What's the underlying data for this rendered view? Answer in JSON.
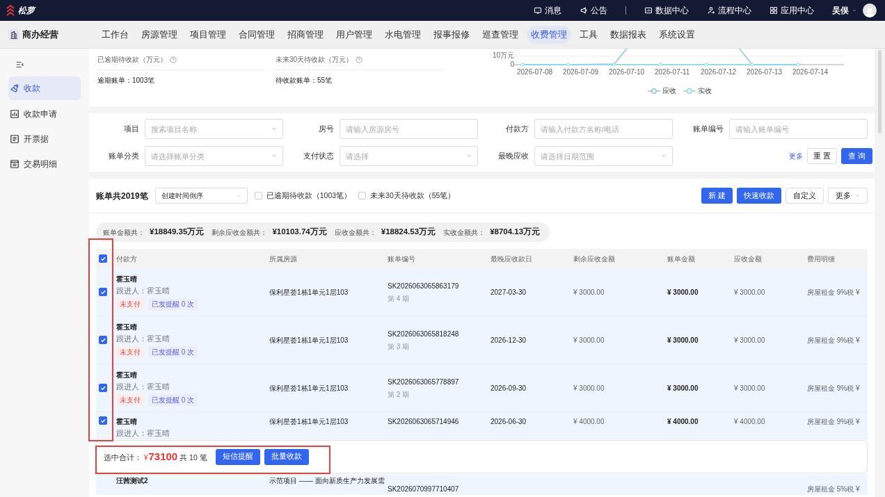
{
  "top_bar": {
    "brand": "松萝",
    "links": [
      {
        "label": "消息"
      },
      {
        "label": "公告"
      },
      {
        "label": "数据中心"
      },
      {
        "label": "流程中心"
      },
      {
        "label": "应用中心"
      }
    ],
    "user": "吴俣"
  },
  "nav": {
    "module": "商办经营",
    "tabs": [
      {
        "label": "工作台",
        "selected": false
      },
      {
        "label": "房源管理",
        "selected": false
      },
      {
        "label": "项目管理",
        "selected": false
      },
      {
        "label": "合同管理",
        "selected": false
      },
      {
        "label": "招商管理",
        "selected": false
      },
      {
        "label": "用户管理",
        "selected": false
      },
      {
        "label": "水电管理",
        "selected": false
      },
      {
        "label": "报事报修",
        "selected": false
      },
      {
        "label": "巡查管理",
        "selected": false
      },
      {
        "label": "收费管理",
        "selected": true
      },
      {
        "label": "工具",
        "selected": false
      },
      {
        "label": "数据报表",
        "selected": false
      },
      {
        "label": "系统设置",
        "selected": false
      }
    ]
  },
  "sidebar": {
    "items": [
      {
        "label": "收款",
        "selected": true
      },
      {
        "label": "收款申请",
        "selected": false
      },
      {
        "label": "开票据",
        "selected": false
      },
      {
        "label": "交易明细",
        "selected": false
      }
    ]
  },
  "stats": [
    {
      "label": "已逾期待收款（万元）",
      "sub": "逾期账单：1003笔"
    },
    {
      "label": "未来30天待收款（万元）",
      "sub": "待收款账单：55笔"
    }
  ],
  "trend_chart": {
    "y_labels": [
      "10万元",
      "0"
    ],
    "x_labels": [
      "2026-07-08",
      "2026-07-09",
      "2026-07-10",
      "2026-07-11",
      "2026-07-12",
      "2026-07-13",
      "2026-07-14"
    ],
    "legend": [
      {
        "label": "应收",
        "color": "#8ec3ea"
      },
      {
        "label": "实收",
        "color": "#86dcef"
      }
    ]
  },
  "filters": [
    {
      "label": "项目",
      "placeholder": "搜索项目名称",
      "kind": "select"
    },
    {
      "label": "房号",
      "placeholder": "请输入房源房号",
      "kind": "input"
    },
    {
      "label": "付款方",
      "placeholder": "请输入付款方名称/电话",
      "kind": "input"
    },
    {
      "label": "账单编号",
      "placeholder": "请输入账单编号",
      "kind": "input"
    },
    {
      "label": "账单分类",
      "placeholder": "请选择账单分类",
      "kind": "select"
    },
    {
      "label": "支付状态",
      "placeholder": "请选择",
      "kind": "select"
    },
    {
      "label": "最晚应收",
      "placeholder": "请选择日期范围",
      "kind": "select"
    }
  ],
  "filter_actions": {
    "more": "更多",
    "reset": "重 置",
    "search": "查 询"
  },
  "toolbar": {
    "title": "账单共2019笔",
    "sort": "创建时间倒序",
    "options": [
      {
        "label": "已逾期待收款（1003笔）",
        "checked": false
      },
      {
        "label": "未来30天待收款（55笔）",
        "checked": false
      }
    ],
    "buttons": [
      {
        "label": "新 建",
        "kind": "primary"
      },
      {
        "label": "快速收款",
        "kind": "primary"
      },
      {
        "label": "自定义",
        "kind": "plain"
      },
      {
        "label": "更多",
        "kind": "dropdown"
      }
    ]
  },
  "summary": [
    {
      "label": "账单金额共：",
      "value": "¥18849.35万元"
    },
    {
      "label": "剩余应收金额共：",
      "value": "¥10103.74万元"
    },
    {
      "label": "应收金额共：",
      "value": "¥18824.53万元"
    },
    {
      "label": "实收金额共：",
      "value": "¥8704.13万元"
    }
  ],
  "table": {
    "select_all": true,
    "columns": [
      "付款方",
      "所属房源",
      "账单编号",
      "最晚应收款日",
      "剩余应收金额",
      "账单金额",
      "应收金额",
      "费用明细"
    ],
    "rows": [
      {
        "checked": true,
        "payer": "霍玉晴",
        "follower": "跟进人：霍玉晴",
        "tags": [
          {
            "label": "未支付",
            "kind": "unpaid"
          },
          {
            "label": "已发提醒 0 次",
            "kind": "reminder"
          }
        ],
        "source": "保利星荟1栋1单元1层103",
        "bill_no": "SK2026063065863179",
        "period": "第 4 期",
        "due": "2027-03-30",
        "remaining": "¥ 3000.00",
        "amount": "¥ 3000.00",
        "receivable": "¥ 3000.00",
        "fee": "房屋租金 9%税 ¥"
      },
      {
        "checked": true,
        "payer": "霍玉晴",
        "follower": "跟进人：霍玉晴",
        "tags": [
          {
            "label": "未支付",
            "kind": "unpaid"
          },
          {
            "label": "已发提醒 0 次",
            "kind": "reminder"
          }
        ],
        "source": "保利星荟1栋1单元1层103",
        "bill_no": "SK2026063065818248",
        "period": "第 3 期",
        "due": "2026-12-30",
        "remaining": "¥ 3000.00",
        "amount": "¥ 3000.00",
        "receivable": "¥ 3000.00",
        "fee": "房屋租金 9%税 ¥"
      },
      {
        "checked": true,
        "payer": "霍玉晴",
        "follower": "跟进人：霍玉晴",
        "tags": [
          {
            "label": "未支付",
            "kind": "unpaid"
          },
          {
            "label": "已发提醒 0 次",
            "kind": "reminder"
          }
        ],
        "source": "保利星荟1栋1单元1层103",
        "bill_no": "SK2026063065778897",
        "period": "第 2 期",
        "due": "2026-09-30",
        "remaining": "¥ 3000.00",
        "amount": "¥ 3000.00",
        "receivable": "¥ 3000.00",
        "fee": "房屋租金 9%税 ¥"
      },
      {
        "checked": true,
        "payer": "霍玉晴",
        "follower": "跟进人：霍玉晴",
        "source": "保利星荟1栋1单元1层103",
        "bill_no": "SK2026063065714946",
        "due": "2026-06-30",
        "remaining": "¥ 4000.00",
        "amount": "¥ 4000.00",
        "receivable": "¥ 4000.00",
        "fee": "房屋租金 9%税 ¥"
      }
    ],
    "partial_row": {
      "payer": "汪茜测试2",
      "source": "示范项目 —— 面向新质生产力发展需",
      "bill_no": "SK2026070997710407",
      "fee": "房屋租金 5%税 ¥"
    }
  },
  "selection_bar": {
    "label": "选中合计：",
    "currency": "¥",
    "total": "73100",
    "count": "共 10 笔",
    "buttons": [
      "短信提醒",
      "批量收款"
    ]
  }
}
